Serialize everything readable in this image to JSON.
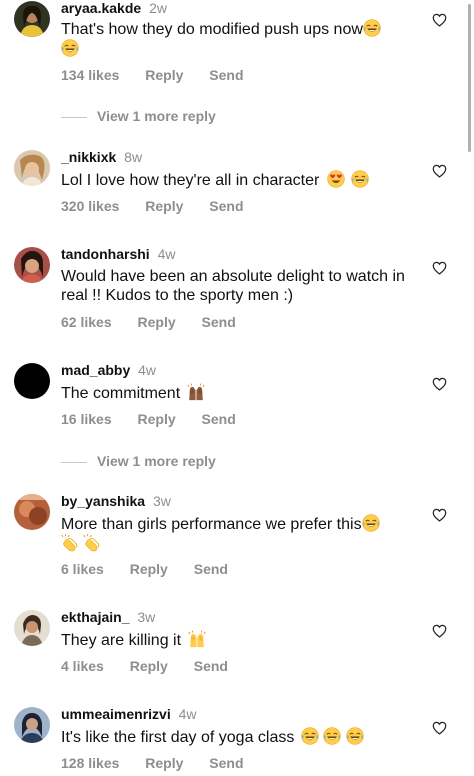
{
  "comments": [
    {
      "username": "aryaa.kakde",
      "time": "2w",
      "text": "That's how they do modified push ups now",
      "likes": "134 likes",
      "reply": "Reply",
      "send": "Send",
      "view_replies": "View 1 more reply",
      "avatar_color": "#3a3a1e"
    },
    {
      "username": "_nikkixk",
      "time": "8w",
      "text": "Lol I love how they're all in character",
      "likes": "320 likes",
      "reply": "Reply",
      "send": "Send",
      "avatar_color": "#c9a47e"
    },
    {
      "username": "tandonharshi",
      "time": "4w",
      "text": "Would have been an absolute delight to watch in real !! Kudos to the sporty men :)",
      "likes": "62 likes",
      "reply": "Reply",
      "send": "Send",
      "avatar_color": "#b56b5a"
    },
    {
      "username": "mad_abby",
      "time": "4w",
      "text": "The commitment",
      "likes": "16 likes",
      "reply": "Reply",
      "send": "Send",
      "view_replies": "View 1 more reply",
      "avatar_color": "#000000"
    },
    {
      "username": "by_yanshika",
      "time": "3w",
      "text": "More than girls performance we prefer this",
      "likes": "6 likes",
      "reply": "Reply",
      "send": "Send",
      "avatar_color": "#b8643a"
    },
    {
      "username": "ekthajain_",
      "time": "3w",
      "text": "They are killing it",
      "likes": "4 likes",
      "reply": "Reply",
      "send": "Send",
      "avatar_color": "#8a7a6a"
    },
    {
      "username": "ummeaimenrizvi",
      "time": "4w",
      "text": "It's like the first day of yoga class",
      "likes": "128 likes",
      "reply": "Reply",
      "send": "Send",
      "avatar_color": "#4a5a78"
    }
  ],
  "colors": {
    "text": "#111111",
    "secondary": "#8e8e8e",
    "divider": "#c7c7c7"
  },
  "icons": {
    "like": "heart-outline-icon",
    "laugh": "face-with-tears-of-joy-emoji",
    "heart_eyes": "smiling-face-with-heart-eyes-emoji",
    "raised_hands": "raising-hands-emoji",
    "clapping": "clapping-hands-emoji"
  }
}
